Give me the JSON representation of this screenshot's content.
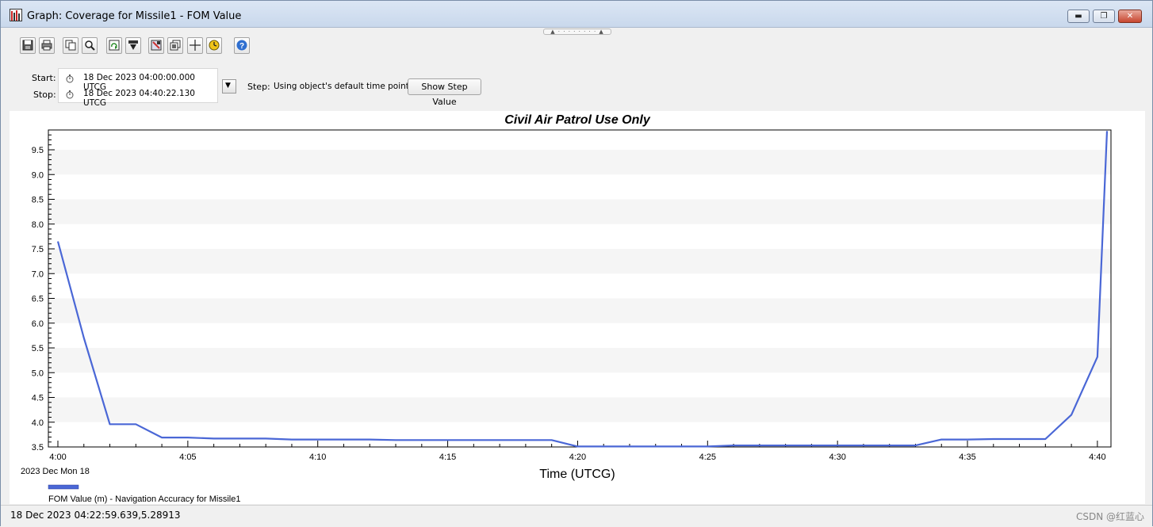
{
  "window": {
    "title": "Graph:  Coverage for Missile1 - FOM Value",
    "minimize_glyph": "▬",
    "maximize_glyph": "❐",
    "close_glyph": "✕"
  },
  "toolbar": {
    "grip_text": "▲ · · · · · · · · ▲",
    "buttons": [
      "save-icon",
      "print-icon",
      "copy-icon",
      "zoom-icon",
      "refresh-icon",
      "export-icon",
      "properties-icon",
      "data-icon",
      "crosshair-icon",
      "animation-icon",
      "help-icon"
    ]
  },
  "time": {
    "start_label": "Start:",
    "start_value": "18 Dec 2023 04:00:00.000 UTCG",
    "stop_label": "Stop:",
    "stop_value": "18 Dec 2023 04:40:22.130 UTCG",
    "step_label": "Step:",
    "step_value": "Using object's default time points",
    "show_step_button": "Show Step Value",
    "dropdown_glyph": "▼"
  },
  "chart_data": {
    "type": "line",
    "title": "Civil Air Patrol Use Only",
    "xlabel": "Time (UTCG)",
    "ylabel": "",
    "x_date_label": "2023 Dec Mon 18",
    "x_unit": "minutes after 4:00",
    "xlim": [
      0,
      40.37
    ],
    "ylim": [
      3.5,
      9.9
    ],
    "x_ticks": [
      {
        "value": 0,
        "label": "4:00"
      },
      {
        "value": 5,
        "label": "4:05"
      },
      {
        "value": 10,
        "label": "4:10"
      },
      {
        "value": 15,
        "label": "4:15"
      },
      {
        "value": 20,
        "label": "4:20"
      },
      {
        "value": 25,
        "label": "4:25"
      },
      {
        "value": 30,
        "label": "4:30"
      },
      {
        "value": 35,
        "label": "4:35"
      },
      {
        "value": 40,
        "label": "4:40"
      }
    ],
    "y_ticks": [
      "3.5",
      "4.0",
      "4.5",
      "5.0",
      "5.5",
      "6.0",
      "6.5",
      "7.0",
      "7.5",
      "8.0",
      "8.5",
      "9.0",
      "9.5"
    ],
    "grid": "alternating horizontal bands",
    "legend_position": "bottom-left",
    "series": [
      {
        "name": "FOM Value (m) - Navigation Accuracy for Missile1",
        "color": "#4a67d6",
        "x": [
          0,
          1,
          2,
          3,
          4,
          5,
          6,
          7,
          8,
          9,
          10,
          11,
          12,
          13,
          14,
          15,
          16,
          17,
          18,
          19,
          20,
          21,
          22,
          23,
          24,
          25,
          26,
          27,
          28,
          29,
          30,
          31,
          32,
          33,
          34,
          35,
          36,
          37,
          38,
          39,
          40,
          40.37
        ],
        "y": [
          7.65,
          5.7,
          3.96,
          3.96,
          3.69,
          3.69,
          3.67,
          3.67,
          3.67,
          3.65,
          3.65,
          3.65,
          3.65,
          3.64,
          3.64,
          3.64,
          3.64,
          3.64,
          3.64,
          3.64,
          3.51,
          3.51,
          3.51,
          3.51,
          3.51,
          3.51,
          3.53,
          3.53,
          3.53,
          3.53,
          3.53,
          3.53,
          3.53,
          3.53,
          3.65,
          3.65,
          3.66,
          3.66,
          3.66,
          4.15,
          5.32,
          9.88
        ]
      }
    ]
  },
  "status": {
    "readout": "18 Dec 2023 04:22:59.639,5.28913",
    "watermark": "CSDN @红蓝心"
  }
}
